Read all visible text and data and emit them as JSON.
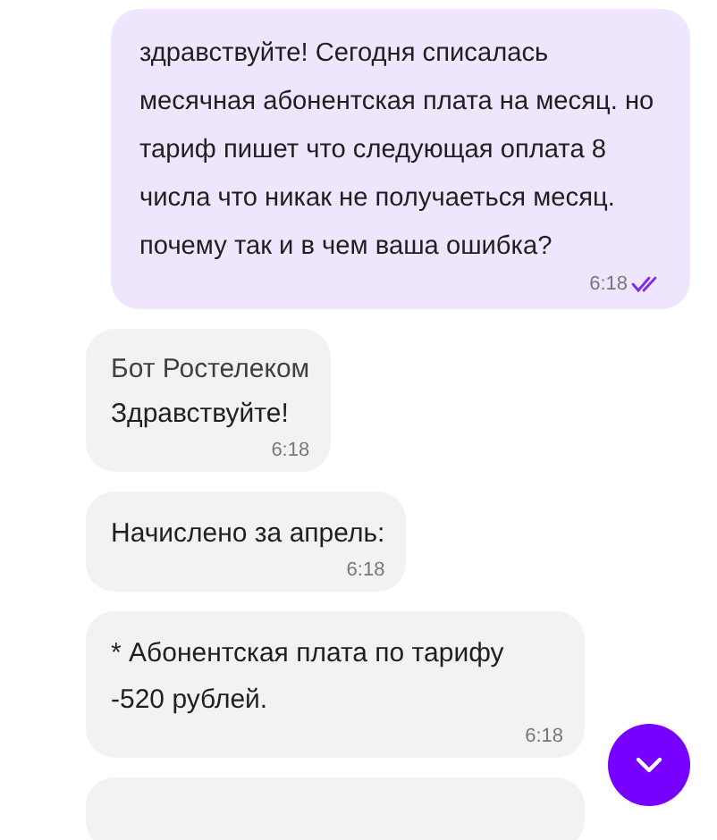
{
  "messages": [
    {
      "kind": "outgoing",
      "text": "здравствуйте! Сегодня списалась месячная абонентская плата на месяц. но тариф пишет что следующая оплата 8 числа что никак не получаеться месяц. почему так и в чем ваша ошибка?",
      "time": "6:18",
      "read": true
    },
    {
      "kind": "incoming",
      "sender": "Бот Ростелеком",
      "text": "Здравствуйте!",
      "time": "6:18"
    },
    {
      "kind": "incoming",
      "text": "Начислено за апрель:",
      "time": "6:18"
    },
    {
      "kind": "incoming",
      "text": "* Абонентская плата по тарифу -520 рублей.",
      "time": "6:18"
    },
    {
      "kind": "incoming"
    }
  ]
}
